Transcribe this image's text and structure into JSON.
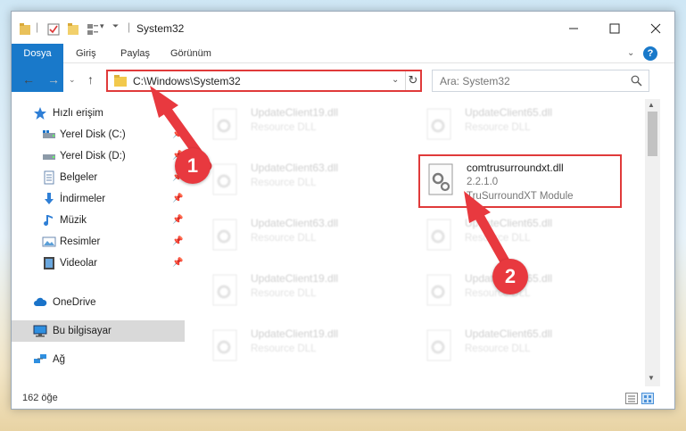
{
  "window": {
    "title": "System32"
  },
  "ribbon": {
    "tabs": [
      {
        "label": "Dosya"
      },
      {
        "label": "Giriş"
      },
      {
        "label": "Paylaş"
      },
      {
        "label": "Görünüm"
      }
    ],
    "help_label": "?"
  },
  "navbar": {
    "address": "C:\\Windows\\System32",
    "search_placeholder": "Ara: System32"
  },
  "sidebar": {
    "items": [
      {
        "label": "Hızlı erişim",
        "icon": "star-icon"
      },
      {
        "label": "Yerel Disk (C:)",
        "icon": "drive-icon"
      },
      {
        "label": "Yerel Disk (D:)",
        "icon": "drive-icon"
      },
      {
        "label": "Belgeler",
        "icon": "documents-icon"
      },
      {
        "label": "İndirmeler",
        "icon": "download-icon"
      },
      {
        "label": "Müzik",
        "icon": "music-icon"
      },
      {
        "label": "Resimler",
        "icon": "pictures-icon"
      },
      {
        "label": "Videolar",
        "icon": "video-icon"
      },
      {
        "label": "OneDrive",
        "icon": "cloud-icon"
      },
      {
        "label": "Bu bilgisayar",
        "icon": "computer-icon"
      },
      {
        "label": "Ağ",
        "icon": "network-icon"
      }
    ]
  },
  "files": {
    "ghost": [
      {
        "name": "UpdateClient19.dll",
        "desc": "Resource DLL"
      },
      {
        "name": "UpdateClient65.dll",
        "desc": "Resource DLL"
      },
      {
        "name": "UpdateClient63.dll",
        "desc": "Resource DLL"
      },
      {
        "name": "UpdateClient63.dll",
        "desc": "Resource DLL"
      },
      {
        "name": "UpdateClient65.dll",
        "desc": "Resource DLL"
      },
      {
        "name": "UpdateClient19.dll",
        "desc": "Resource DLL"
      },
      {
        "name": "UpdateClient65.dll",
        "desc": "Resource DLL"
      },
      {
        "name": "UpdateClient19.dll",
        "desc": "Resource DLL"
      },
      {
        "name": "UpdateClient65.dll",
        "desc": "Resource DLL"
      }
    ],
    "target": {
      "name": "comtrusurroundxt.dll",
      "version": "2.2.1.0",
      "desc": "TruSurroundXT Module"
    }
  },
  "status": {
    "count": "162 öğe"
  },
  "callouts": {
    "one": "1",
    "two": "2"
  },
  "colors": {
    "accent": "#1979ca",
    "callout": "#e8393f",
    "highlight_border": "#e03a3a"
  }
}
